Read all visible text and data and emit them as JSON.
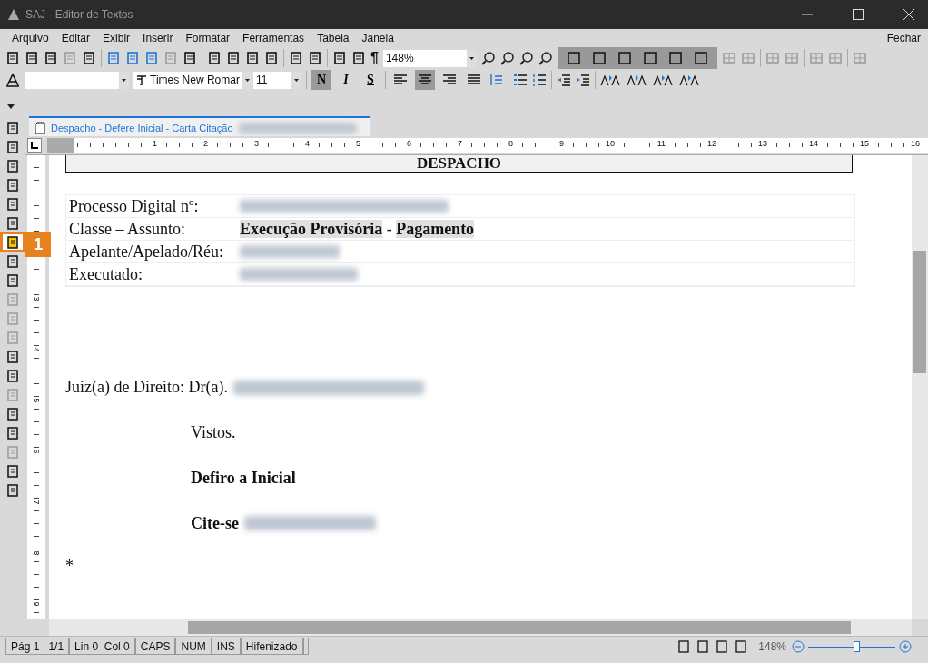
{
  "window": {
    "title": "SAJ - Editor de Textos"
  },
  "menu": [
    "Arquivo",
    "Editar",
    "Exibir",
    "Inserir",
    "Formatar",
    "Ferramentas",
    "Tabela",
    "Janela"
  ],
  "close_label": "Fechar",
  "toolbar": {
    "pilcrow": "¶",
    "zoom": "148%",
    "font": "Times New Romar",
    "size": "11",
    "format_buttons": [
      {
        "label": "N",
        "selected": true
      },
      {
        "label": "I",
        "selected": false
      },
      {
        "label": "S",
        "selected": false
      }
    ],
    "align_buttons": [
      {
        "selected": false
      },
      {
        "selected": true
      },
      {
        "selected": false
      },
      {
        "selected": false
      }
    ]
  },
  "tab": {
    "title": "Despacho - Defere Inicial - Carta Citação"
  },
  "ruler": [
    "1",
    "2",
    "3",
    "4",
    "5",
    "6",
    "7",
    "8",
    "9",
    "10",
    "11",
    "12",
    "13",
    "14",
    "15",
    "16"
  ],
  "vertical_ruler": [
    "3",
    "4",
    "5",
    "6",
    "7",
    "8",
    "9"
  ],
  "callout": {
    "label": "1"
  },
  "document": {
    "heading": "DESPACHO",
    "rows": [
      {
        "label": "Processo Digital nº:"
      },
      {
        "label": "Classe – Assunto:",
        "value": "**Execução Provisória** - **Pagamento**"
      },
      {
        "label": "Apelante/Apelado/Réu:"
      },
      {
        "label": "Executado:"
      }
    ],
    "judge": "Juiz(a) de Direito: Dr(a).",
    "paragraphs": [
      {
        "text": "Vistos.",
        "bold": false,
        "redacted": false
      },
      {
        "text": "Defiro a Inicial",
        "bold": true,
        "redacted": false
      },
      {
        "text": "Cite-se",
        "bold": true,
        "redacted": true
      }
    ],
    "end_mark": "*"
  },
  "status": {
    "page": "Pág 1",
    "pages": "1/1",
    "line": "Lin 0",
    "col": "Col 0",
    "flags": [
      "CAPS",
      "NUM",
      "INS",
      "Hifenizado"
    ],
    "zoom": "148%",
    "zoom_slider": {
      "level": 0.55
    }
  }
}
